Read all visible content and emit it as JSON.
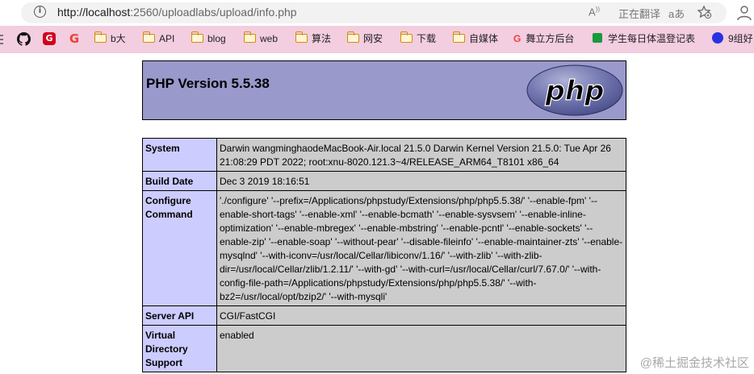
{
  "browser": {
    "url_scheme_host": "http://localhost",
    "url_rest": ":2560/uploadlabs/upload/info.php",
    "read_aloud": "A",
    "translate_label": "正在翻译",
    "text_size": "aあ"
  },
  "bookmarks": {
    "items": [
      {
        "type": "folder",
        "label": "b大"
      },
      {
        "type": "folder",
        "label": "API"
      },
      {
        "type": "folder",
        "label": "blog"
      },
      {
        "type": "folder",
        "label": "web"
      },
      {
        "type": "folder",
        "label": "算法"
      },
      {
        "type": "folder",
        "label": "网安"
      },
      {
        "type": "folder",
        "label": "下载"
      },
      {
        "type": "folder",
        "label": "自媒体"
      },
      {
        "type": "link",
        "label": "舞立方后台"
      },
      {
        "type": "link",
        "label": "学生每日体温登记表"
      },
      {
        "type": "link",
        "label": "9组好"
      }
    ]
  },
  "php": {
    "title": "PHP Version 5.5.38",
    "logo_text": "php",
    "rows": [
      {
        "key": "System",
        "value": "Darwin wangminghaodeMacBook-Air.local 21.5.0 Darwin Kernel Version 21.5.0: Tue Apr 26 21:08:29 PDT 2022; root:xnu-8020.121.3~4/RELEASE_ARM64_T8101 x86_64"
      },
      {
        "key": "Build Date",
        "value": "Dec 3 2019 18:16:51"
      },
      {
        "key": "Configure Command",
        "value": "'./configure' '--prefix=/Applications/phpstudy/Extensions/php/php5.5.38/' '--enable-fpm' '--enable-short-tags' '--enable-xml' '--enable-bcmath' '--enable-sysvsem' '--enable-inline-optimization' '--enable-mbregex' '--enable-mbstring' '--enable-pcntl' '--enable-sockets' '--enable-zip' '--enable-soap' '--without-pear' '--disable-fileinfo' '--enable-maintainer-zts' '--enable-mysqlnd' '--with-iconv=/usr/local/Cellar/libiconv/1.16/' '--with-zlib' '--with-zlib-dir=/usr/local/Cellar/zlib/1.2.11/' '--with-gd' '--with-curl=/usr/local/Cellar/curl/7.67.0/' '--with-config-file-path=/Applications/phpstudy/Extensions/php/php5.5.38/' '--with-bz2=/usr/local/opt/bzip2/' '--with-mysqli'"
      },
      {
        "key": "Server API",
        "value": "CGI/FastCGI"
      },
      {
        "key": "Virtual Directory Support",
        "value": "enabled"
      }
    ]
  },
  "watermark": "@稀土掘金技术社区"
}
